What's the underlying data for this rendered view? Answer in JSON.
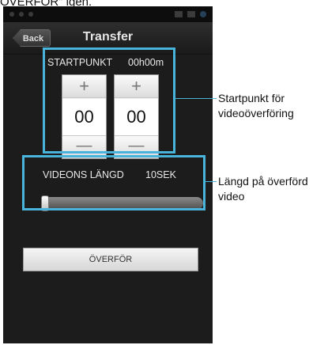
{
  "page_caption": "ÖVERFÖR\" igen.",
  "titlebar": {
    "back_label": "Back",
    "title": "Transfer"
  },
  "start_panel": {
    "label": "STARTPUNKT",
    "time": "00h00m",
    "hours_value": "00",
    "minutes_value": "00",
    "plus_glyph": "+",
    "minus_glyph": "—"
  },
  "length_panel": {
    "label": "VIDEONS LÄNGD",
    "value": "10SEK",
    "slider_level": 0.0
  },
  "transfer_button_label": "ÖVERFÖR",
  "callouts": {
    "start": {
      "line1": "Startpunkt för",
      "line2": "videoöverföring"
    },
    "length": {
      "line1": "Längd på överförd",
      "line2": "video"
    }
  },
  "colors": {
    "highlight": "#48b4dc",
    "background": "#1c1c1c"
  }
}
